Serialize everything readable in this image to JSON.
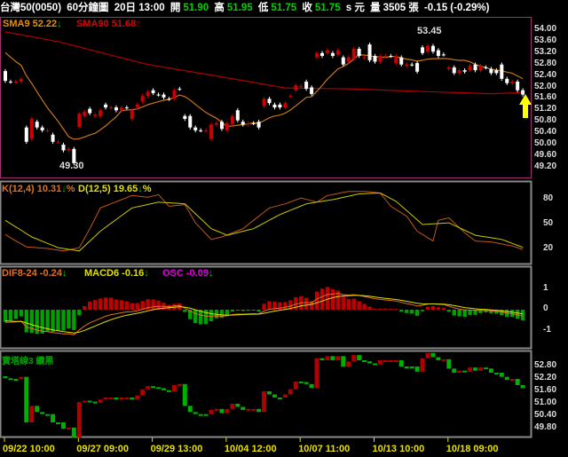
{
  "header": {
    "symbol": "台灣50(0050)",
    "period": "60分鐘圖",
    "datetime": "20日 13:00",
    "open_label": "開",
    "open": "51.90",
    "high_label": "高",
    "high": "51.95",
    "low_label": "低",
    "low": "51.75",
    "close_label": "收",
    "close": "51.75",
    "unit": "s 元",
    "volume_label": "量",
    "volume": "3505",
    "volume_unit": "張",
    "change": "-0.15 (-0.29%)"
  },
  "legends": {
    "sma9": "SMA9 52.22",
    "sma90": "SMA90 51.68",
    "k": "K(12,4) 10.31",
    "d": "D(12,5) 19.65",
    "pct": "%",
    "dif": "DIF8-24 -0.24",
    "macd": "MACD6 -0.16",
    "osc": "OSC -0.09",
    "tower": "寶塔線3 續黑",
    "down": "↓",
    "up": "↑"
  },
  "annotations": {
    "low": "49.30",
    "high": "53.45"
  },
  "axes": {
    "price": [
      "54.00",
      "53.60",
      "53.20",
      "52.80",
      "52.40",
      "52.00",
      "51.60",
      "51.20",
      "50.80",
      "50.40",
      "50.00",
      "49.60",
      "49.20"
    ],
    "kd": [
      "80",
      "50",
      "20"
    ],
    "macd": [
      "1",
      "0",
      "-1"
    ],
    "tower": [
      "52.80",
      "52.20",
      "51.60",
      "51.00",
      "50.40",
      "49.80"
    ]
  },
  "dates": [
    "09/22 10:00",
    "09/27 09:00",
    "09/29 13:00",
    "10/04 12:00",
    "10/07 11:00",
    "10/13 10:00",
    "10/18 09:00"
  ],
  "colors": {
    "up": "#cc0000",
    "down": "#ffffff",
    "sma9": "#c87818",
    "sma90": "#b00000",
    "k": "#c05818",
    "d": "#c8c800",
    "tower_up": "#b00000",
    "tower_down": "#00b000",
    "border": "#a03070"
  },
  "chart_data": {
    "type": "candlestick",
    "ohlc_open_close": [
      [
        52.57,
        52.23
      ],
      [
        52.2,
        52.2
      ],
      [
        52.2,
        52.2
      ],
      [
        52.2,
        52.3
      ],
      [
        50.6,
        50.1
      ],
      [
        50.2,
        50.9
      ],
      [
        50.8,
        50.6
      ],
      [
        50.6,
        50.5
      ],
      [
        50.5,
        50.5
      ],
      [
        50.35,
        50.1
      ],
      [
        50.1,
        50.1
      ],
      [
        50.0,
        49.8
      ],
      [
        49.8,
        49.85
      ],
      [
        49.85,
        49.35
      ],
      [
        50.62,
        51.08
      ],
      [
        51.0,
        51.15
      ],
      [
        51.25,
        51.1
      ],
      [
        51.0,
        51.05
      ],
      [
        51.0,
        51.2
      ],
      [
        51.4,
        51.3
      ],
      [
        51.3,
        51.3
      ],
      [
        51.3,
        51.2
      ],
      [
        51.2,
        51.3
      ],
      [
        51.3,
        51.3
      ],
      [
        50.9,
        51.2
      ],
      [
        51.3,
        51.4
      ],
      [
        51.5,
        51.7
      ],
      [
        51.7,
        51.85
      ],
      [
        51.9,
        51.8
      ],
      [
        51.75,
        51.75
      ],
      [
        51.75,
        51.65
      ],
      [
        51.6,
        51.6
      ],
      [
        51.6,
        51.9
      ],
      [
        51.95,
        51.95
      ],
      [
        51.0,
        50.9
      ],
      [
        51.0,
        50.6
      ],
      [
        50.6,
        50.5
      ],
      [
        50.5,
        50.5
      ],
      [
        50.5,
        50.5
      ],
      [
        50.2,
        50.7
      ],
      [
        50.7,
        50.75
      ],
      [
        50.8,
        50.55
      ],
      [
        50.5,
        50.75
      ],
      [
        50.7,
        51.0
      ],
      [
        51.2,
        50.85
      ],
      [
        50.8,
        50.7
      ],
      [
        50.7,
        50.75
      ],
      [
        50.75,
        50.75
      ],
      [
        50.8,
        50.6
      ],
      [
        51.35,
        51.6
      ],
      [
        51.6,
        51.45
      ],
      [
        51.4,
        51.3
      ],
      [
        51.4,
        51.3
      ],
      [
        51.3,
        51.45
      ],
      [
        51.7,
        51.7
      ],
      [
        51.9,
        52.07
      ],
      [
        52.05,
        52.05
      ],
      [
        52.2,
        51.95
      ],
      [
        52.0,
        51.77
      ],
      [
        53.05,
        53.2
      ],
      [
        53.2,
        53.1
      ],
      [
        53.2,
        53.3
      ],
      [
        53.2,
        53.1
      ],
      [
        53.15,
        53.3
      ],
      [
        53.05,
        52.8
      ],
      [
        52.9,
        53.05
      ],
      [
        53.0,
        53.35
      ],
      [
        53.35,
        53.1
      ],
      [
        53.05,
        53.05
      ],
      [
        53.5,
        52.95
      ],
      [
        53.1,
        52.9
      ],
      [
        52.9,
        53.1
      ],
      [
        53.1,
        53.1
      ],
      [
        53.1,
        53.1
      ],
      [
        52.85,
        53.1
      ],
      [
        53.05,
        52.8
      ],
      [
        52.75,
        52.8
      ],
      [
        52.8,
        52.8
      ],
      [
        52.85,
        52.55
      ],
      [
        53.4,
        53.2
      ],
      [
        53.25,
        53.45
      ],
      [
        53.45,
        53.25
      ],
      [
        53.3,
        53.1
      ],
      [
        53.15,
        53.15
      ],
      [
        52.65,
        52.7
      ],
      [
        52.7,
        52.5
      ],
      [
        52.5,
        52.6
      ],
      [
        52.6,
        52.55
      ],
      [
        52.6,
        52.75
      ],
      [
        52.8,
        52.6
      ],
      [
        52.6,
        52.75
      ],
      [
        52.7,
        52.7
      ],
      [
        52.65,
        52.5
      ],
      [
        52.6,
        52.5
      ],
      [
        52.8,
        52.3
      ],
      [
        52.3,
        52.15
      ],
      [
        52.15,
        52.2
      ],
      [
        52.2,
        51.9
      ],
      [
        51.9,
        51.75
      ]
    ],
    "sma90_points": [
      [
        0,
        53.94
      ],
      [
        10,
        53.6
      ],
      [
        27,
        52.8
      ],
      [
        40,
        52.4
      ],
      [
        53,
        51.98
      ],
      [
        65,
        51.95
      ],
      [
        80,
        51.85
      ],
      [
        92,
        51.78
      ],
      [
        98,
        51.82
      ]
    ],
    "k_points": [
      [
        0,
        38
      ],
      [
        2,
        30
      ],
      [
        4,
        23
      ],
      [
        8,
        21
      ],
      [
        11,
        18
      ],
      [
        14,
        22
      ],
      [
        16,
        45
      ],
      [
        18,
        70
      ],
      [
        22,
        80
      ],
      [
        24,
        85
      ],
      [
        27,
        83
      ],
      [
        29,
        86
      ],
      [
        31,
        72
      ],
      [
        34,
        74
      ],
      [
        36,
        52
      ],
      [
        39,
        32
      ],
      [
        41,
        35
      ],
      [
        45,
        45
      ],
      [
        48,
        60
      ],
      [
        50,
        70
      ],
      [
        53,
        75
      ],
      [
        56,
        82
      ],
      [
        59,
        77
      ],
      [
        61,
        85
      ],
      [
        65,
        90
      ],
      [
        68,
        90
      ],
      [
        71,
        88
      ],
      [
        73,
        72
      ],
      [
        76,
        60
      ],
      [
        78,
        42
      ],
      [
        81,
        30
      ],
      [
        82,
        55
      ],
      [
        84,
        58
      ],
      [
        87,
        40
      ],
      [
        89,
        30
      ],
      [
        92,
        29
      ],
      [
        96,
        24
      ],
      [
        98,
        20
      ],
      [
        99,
        14
      ]
    ],
    "d_points": [
      [
        0,
        55
      ],
      [
        5,
        35
      ],
      [
        10,
        22
      ],
      [
        14,
        18
      ],
      [
        18,
        42
      ],
      [
        24,
        70
      ],
      [
        29,
        77
      ],
      [
        34,
        75
      ],
      [
        39,
        45
      ],
      [
        42,
        37
      ],
      [
        47,
        45
      ],
      [
        52,
        62
      ],
      [
        57,
        75
      ],
      [
        62,
        80
      ],
      [
        67,
        87
      ],
      [
        71,
        88
      ],
      [
        74,
        78
      ],
      [
        79,
        50
      ],
      [
        84,
        52
      ],
      [
        89,
        37
      ],
      [
        94,
        32
      ],
      [
        99,
        20
      ]
    ],
    "price_range": [
      49.2,
      54.0
    ],
    "kd_range": [
      0,
      100
    ],
    "macd_range": [
      -1.5,
      1.5
    ]
  }
}
